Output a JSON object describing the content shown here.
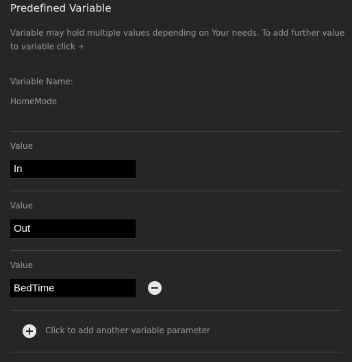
{
  "panel": {
    "title": "Predefined Variable",
    "description": "Variable may hold multiple values depending on Your needs. To add further value to variable click +"
  },
  "variable": {
    "name_label": "Variable Name:",
    "name_value": "HomeMode"
  },
  "values": [
    {
      "label": "Value",
      "value": "In"
    },
    {
      "label": "Value",
      "value": "Out"
    },
    {
      "label": "Value",
      "value": "BedTime"
    }
  ],
  "add_parameter": {
    "label": "Click to add another variable parameter",
    "icon": "plus-circle-icon"
  },
  "remove_icon": "minus-circle-icon",
  "colors": {
    "background": "#262626",
    "text_muted": "#9a9a9a",
    "title": "#ececec",
    "input_bg": "#000000",
    "divider": "#4a4a4a"
  }
}
